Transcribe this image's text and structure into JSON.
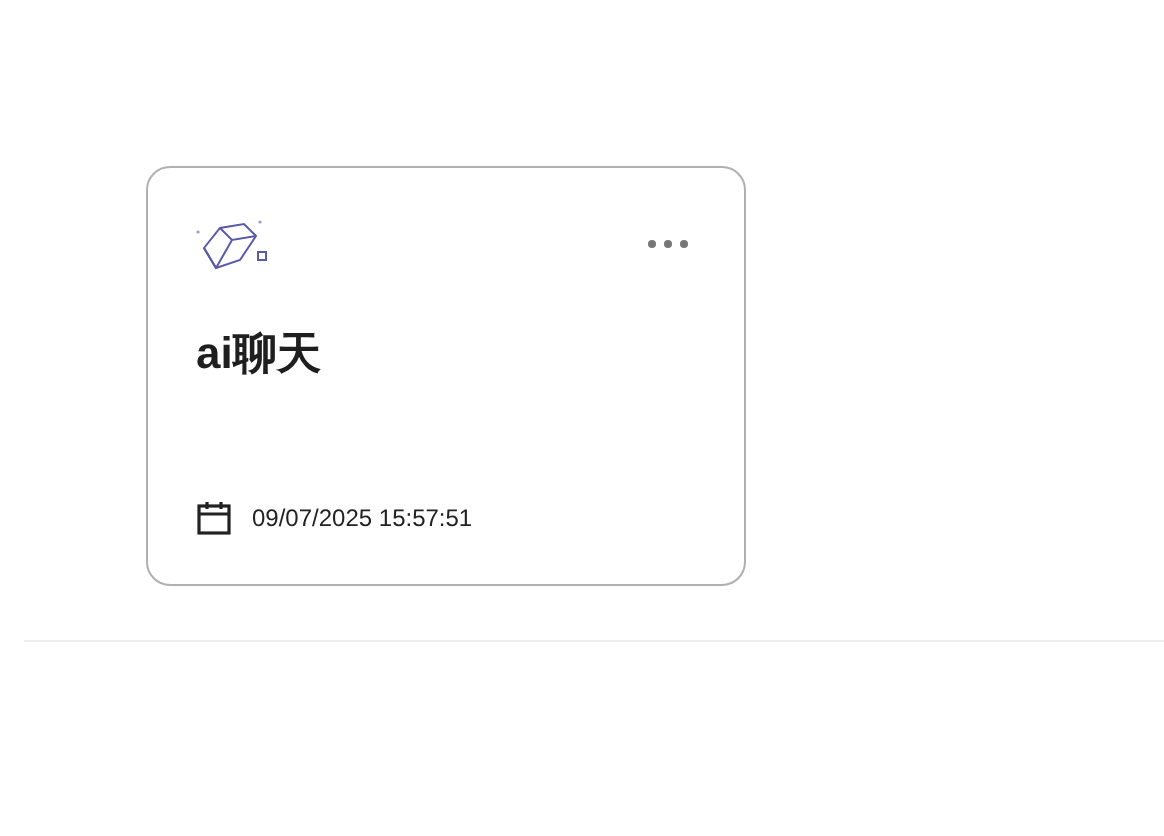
{
  "card": {
    "title": "ai聊天",
    "date": "09/07/2025 15:57:51"
  }
}
